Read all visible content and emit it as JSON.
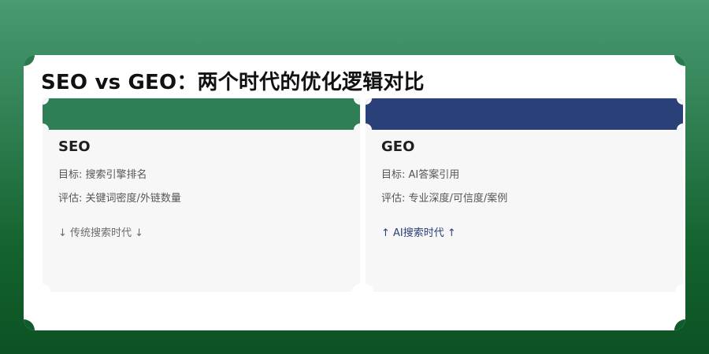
{
  "page": {
    "title": "SEO vs GEO：两个时代的优化逻辑对比"
  },
  "colors": {
    "background_top": "#4a9a72",
    "background_bottom": "#0c5224",
    "seo_header": "#2f7f55",
    "geo_header": "#2a4078",
    "card_body": "#f7f7f7"
  },
  "cards": [
    {
      "title": "SEO",
      "goal": "目标: 搜索引擎排名",
      "evaluation": "评估: 关键词密度/外链数量",
      "trend": "↓ 传统搜索时代 ↓"
    },
    {
      "title": "GEO",
      "goal": "目标: AI答案引用",
      "evaluation": "评估: 专业深度/可信度/案例",
      "trend": "↑ AI搜索时代 ↑"
    }
  ]
}
